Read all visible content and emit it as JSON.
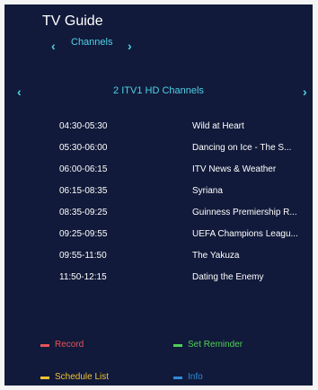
{
  "header": {
    "title": "TV Guide"
  },
  "category": {
    "label": "Channels"
  },
  "channel": {
    "label": "2 ITV1 HD Channels"
  },
  "programs": [
    {
      "time": "04:30-05:30",
      "title": "Wild at Heart"
    },
    {
      "time": "05:30-06:00",
      "title": "Dancing on Ice - The S..."
    },
    {
      "time": "06:00-06:15",
      "title": "ITV News & Weather"
    },
    {
      "time": "06:15-08:35",
      "title": "Syriana"
    },
    {
      "time": "08:35-09:25",
      "title": "Guinness Premiership R..."
    },
    {
      "time": "09:25-09:55",
      "title": "UEFA Champions Leagu..."
    },
    {
      "time": "09:55-11:50",
      "title": "The Yakuza"
    },
    {
      "time": "11:50-12:15",
      "title": "Dating the Enemy"
    }
  ],
  "legend": {
    "record": {
      "label": "Record",
      "color": "#e8535a"
    },
    "set_reminder": {
      "label": "Set Reminder",
      "color": "#4fcf5a"
    },
    "schedule_list": {
      "label": "Schedule List",
      "color": "#f2c230"
    },
    "info": {
      "label": "Info",
      "color": "#2f8ad8"
    }
  },
  "colors": {
    "background": "#111a3a",
    "accent": "#4fd1e8",
    "text": "#ffffff"
  }
}
